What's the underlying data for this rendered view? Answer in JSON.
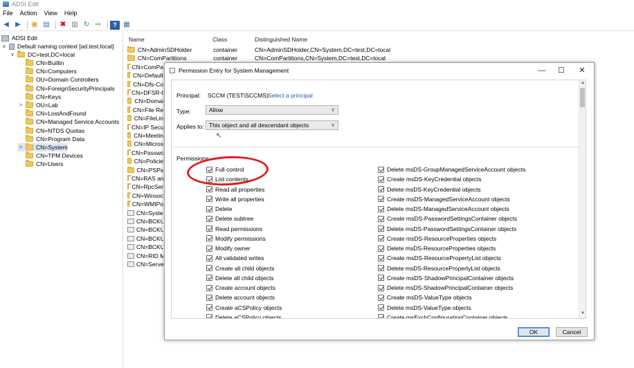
{
  "window": {
    "title": "ADSI Edit"
  },
  "menu": [
    "File",
    "Action",
    "View",
    "Help"
  ],
  "tree": {
    "root": "ADSI Edit",
    "context": "Default naming context [ad.test.local]",
    "domain": "DC=test,DC=local",
    "children": [
      {
        "label": "CN=Builtin",
        "expander": ""
      },
      {
        "label": "CN=Computers",
        "expander": ""
      },
      {
        "label": "OU=Domain Controllers",
        "expander": ""
      },
      {
        "label": "CN=ForeignSecurityPrincipals",
        "expander": ""
      },
      {
        "label": "CN=Keys",
        "expander": ""
      },
      {
        "label": "OU=Lab",
        "expander": ">"
      },
      {
        "label": "CN=LostAndFound",
        "expander": ""
      },
      {
        "label": "CN=Managed Service Accounts",
        "expander": ""
      },
      {
        "label": "CN=NTDS Quotas",
        "expander": ""
      },
      {
        "label": "CN=Program Data",
        "expander": ""
      },
      {
        "label": "CN=System",
        "expander": ">"
      },
      {
        "label": "CN=TPM Devices",
        "expander": ""
      },
      {
        "label": "CN=Users",
        "expander": ""
      }
    ],
    "selected": "CN=System"
  },
  "list": {
    "columns": [
      "Name",
      "Class",
      "Distinguished Name"
    ],
    "rows": [
      {
        "name": "CN=AdminSDHolder",
        "class": "container",
        "dn": "CN=AdminSDHolder,CN=System,DC=test,DC=local",
        "icon": "folder"
      },
      {
        "name": "CN=ComPartitions",
        "class": "container",
        "dn": "CN=ComPartitions,CN=System,DC=test,DC=local",
        "icon": "folder"
      },
      {
        "name": "CN=ComPa",
        "class": "",
        "dn": "",
        "icon": "folder"
      },
      {
        "name": "CN=Default",
        "class": "",
        "dn": "",
        "icon": "folder"
      },
      {
        "name": "CN=Dfs-Co",
        "class": "",
        "dn": "",
        "icon": "folder"
      },
      {
        "name": "CN=DFSR-G",
        "class": "",
        "dn": "",
        "icon": "folder"
      },
      {
        "name": "CN=Domai",
        "class": "",
        "dn": "",
        "icon": "folder"
      },
      {
        "name": "CN=File Re",
        "class": "",
        "dn": "",
        "icon": "folder"
      },
      {
        "name": "CN=FileLin",
        "class": "",
        "dn": "",
        "icon": "folder"
      },
      {
        "name": "CN=IP Secu",
        "class": "",
        "dn": "",
        "icon": "folder"
      },
      {
        "name": "CN=Meetin",
        "class": "",
        "dn": "",
        "icon": "folder"
      },
      {
        "name": "CN=Micros",
        "class": "",
        "dn": "",
        "icon": "folder"
      },
      {
        "name": "CN=Passwo",
        "class": "",
        "dn": "",
        "icon": "folder"
      },
      {
        "name": "CN=Policie",
        "class": "",
        "dn": "",
        "icon": "folder"
      },
      {
        "name": "CN=PSPs",
        "class": "",
        "dn": "",
        "icon": "folder"
      },
      {
        "name": "CN=RAS an",
        "class": "",
        "dn": "",
        "icon": "folder"
      },
      {
        "name": "CN=RpcSer",
        "class": "",
        "dn": "",
        "icon": "folder"
      },
      {
        "name": "CN=Winsoc",
        "class": "",
        "dn": "",
        "icon": "folder"
      },
      {
        "name": "CN=WMIPo",
        "class": "",
        "dn": "",
        "icon": "folder"
      },
      {
        "name": "CN=System",
        "class": "",
        "dn": "",
        "icon": "object"
      },
      {
        "name": "CN=BCKUP",
        "class": "",
        "dn": "",
        "icon": "object"
      },
      {
        "name": "CN=BCKUP",
        "class": "",
        "dn": "",
        "icon": "object"
      },
      {
        "name": "CN=BCKUP",
        "class": "",
        "dn": "",
        "icon": "object"
      },
      {
        "name": "CN=BCKUP",
        "class": "",
        "dn": "",
        "icon": "object"
      },
      {
        "name": "CN=RID Ma",
        "class": "",
        "dn": "",
        "icon": "object"
      },
      {
        "name": "CN=Server",
        "class": "",
        "dn": "",
        "icon": "object"
      }
    ]
  },
  "dialog": {
    "title": "Permission Entry for System Management",
    "principal_label": "Principal:",
    "principal_value": "SCCM (TEST\\SCCMS)",
    "select_principal": "Select a principal",
    "type_label": "Type:",
    "type_value": "Allow",
    "applies_label": "Applies to:",
    "applies_value": "This object and all descendant objects",
    "permissions_label": "Permissions:",
    "permissions_left": [
      "Full control",
      "List contents",
      "Read all properties",
      "Write all properties",
      "Delete",
      "Delete subtree",
      "Read permissions",
      "Modify permissions",
      "Modify owner",
      "All validated writes",
      "Create all child objects",
      "Delete all child objects",
      "Create account objects",
      "Delete account objects",
      "Create aCSPolicy objects",
      "Delete aCSPolicy objects"
    ],
    "permissions_right": [
      "Delete msDS-GroupManagedServiceAccount objects",
      "Create msDS-KeyCredential objects",
      "Delete msDS-KeyCredential objects",
      "Create msDS-ManagedServiceAccount objects",
      "Delete msDS-ManagedServiceAccount objects",
      "Create msDS-PasswordSettingsContainer objects",
      "Delete msDS-PasswordSettingsContainer objects",
      "Create msDS-ResourceProperties objects",
      "Delete msDS-ResourceProperties objects",
      "Create msDS-ResourcePropertyList objects",
      "Delete msDS-ResourcePropertyList objects",
      "Create msDS-ShadowPrincipalContainer objects",
      "Delete msDS-ShadowPrincipalContainer objects",
      "Create msDS-ValueType objects",
      "Delete msDS-ValueType objects",
      "Create msExchConfigurationContainer objects"
    ],
    "ok": "OK",
    "cancel": "Cancel",
    "minimize": "—",
    "maximize": "☐",
    "close": "✕"
  },
  "colors": {
    "highlight_ellipse": "#e01c1c",
    "link": "#1a5fb4",
    "selection": "#d9e6f5"
  }
}
